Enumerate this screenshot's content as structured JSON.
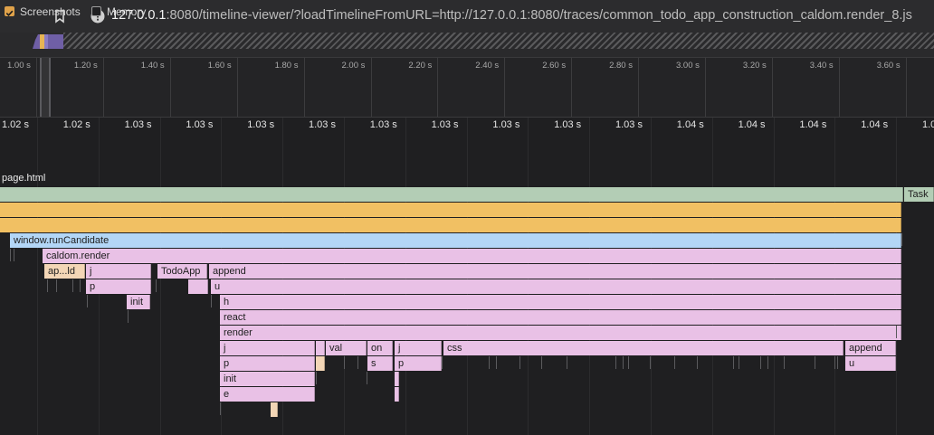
{
  "browser": {
    "url_host": "127.0.0.1",
    "url_rest": ":8080/timeline-viewer/?loadTimelineFromURL=http://127.0.0.1:8080/traces/common_todo_app_construction_caldom.render_8.js"
  },
  "toolbar": {
    "screenshots_label": "Screenshots",
    "screenshots_checked": true,
    "memory_label": "Memory",
    "memory_checked": false
  },
  "overview": {
    "ticks": [
      "1.00 s",
      "1.20 s",
      "1.40 s",
      "1.60 s",
      "1.80 s",
      "2.00 s",
      "2.20 s",
      "2.40 s",
      "2.60 s",
      "2.80 s",
      "3.00 s",
      "3.20 s",
      "3.40 s",
      "3.60 s"
    ]
  },
  "ruler": {
    "ticks": [
      "1.02 s",
      "1.02 s",
      "1.03 s",
      "1.03 s",
      "1.03 s",
      "1.03 s",
      "1.03 s",
      "1.03 s",
      "1.03 s",
      "1.03 s",
      "1.03 s",
      "1.04 s",
      "1.04 s",
      "1.04 s",
      "1.04 s",
      "1.0"
    ]
  },
  "main_thread_label": "page.html",
  "flame": {
    "task": "Task",
    "window_run": "window.runCandidate",
    "caldom_render": "caldom.render",
    "ap_ld": "ap...ld",
    "j1": "j",
    "todoapp": "TodoApp",
    "append1": "append",
    "p1": "p",
    "u1": "u",
    "init1": "init",
    "h": "h",
    "react": "react",
    "render": "render",
    "j2": "j",
    "val": "val",
    "on": "on",
    "j3": "j",
    "css": "css",
    "append2": "append",
    "p2": "p",
    "s": "s",
    "p3": "p",
    "u2": "u",
    "init2": "init",
    "e": "e"
  },
  "colors": {
    "task": "#b3cdb5",
    "script": "#f1c063",
    "call": "#b3d6f6",
    "function": "#e9c1e6",
    "checkbox_accent": "#e0a24a"
  }
}
